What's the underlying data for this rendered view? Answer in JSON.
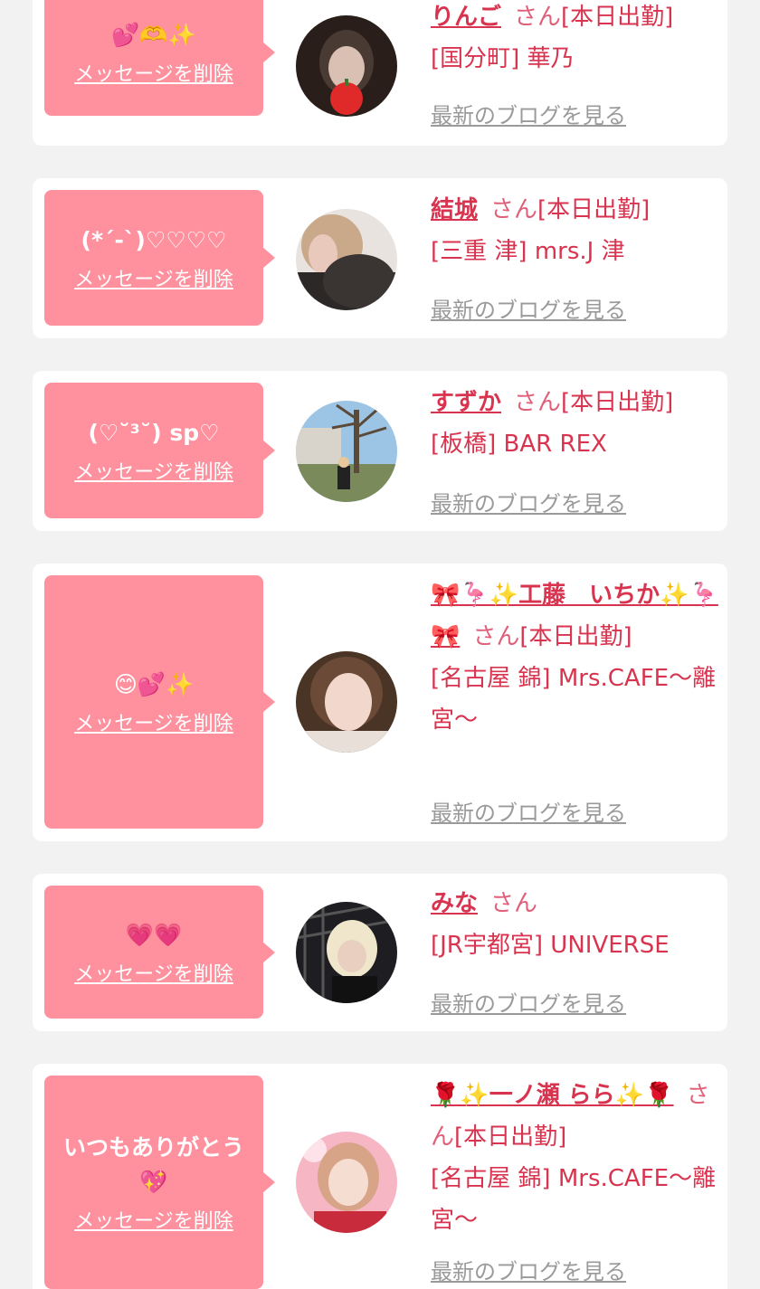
{
  "delete_label": "メッセージを削除",
  "blog_label": "最新のブログを見る",
  "cards": [
    {
      "message": "💕🫶✨",
      "name": "りんご",
      "san": "さん",
      "status": "[本日出勤]",
      "shop": "[国分町] 華乃"
    },
    {
      "message": "(*´-`)♡♡♡♡",
      "name": "結城",
      "san": "さん",
      "status": "[本日出勤]",
      "shop": "[三重 津] mrs.J 津"
    },
    {
      "message": "(♡˘³˘) sp♡",
      "name": "すずか",
      "san": "さん",
      "status": "[本日出勤]",
      "shop": "[板橋] BAR REX"
    },
    {
      "message": "😊💕✨",
      "name": "🎀🦩✨工藤　いちか✨🦩🎀",
      "san": "さん",
      "status": "[本日出勤]",
      "shop": "[名古屋 錦] Mrs.CAFE〜離宮〜"
    },
    {
      "message": "💗💗",
      "name": "みな",
      "san": "さん",
      "status": "",
      "shop": "[JR宇都宮] UNIVERSE"
    },
    {
      "message": "いつもありがとう💖",
      "name": "🌹✨一ノ瀬 らら✨🌹",
      "san": "さん",
      "status": "[本日出勤]",
      "shop": "[名古屋 錦] Mrs.CAFE〜離宮〜"
    }
  ],
  "colors": {
    "background": "#f2f2f2",
    "bubble": "#ff919f",
    "accent": "#d9344f",
    "link_gray": "#9a9a9a"
  }
}
